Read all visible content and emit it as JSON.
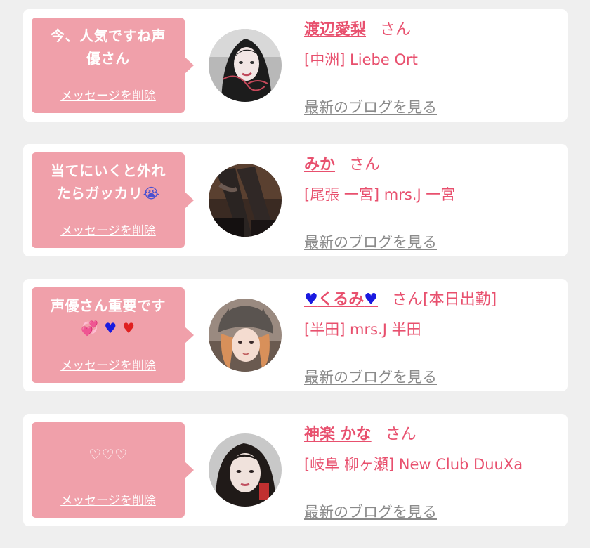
{
  "cards": [
    {
      "message": "今、人気ですね声\n優さん",
      "delete_label": "メッセージを削除",
      "name": "渡辺愛梨",
      "san": "さん",
      "shop": "[中洲] Liebe Ort",
      "blog_label": "最新のブログを見る",
      "avatar_icon": "woman-portrait-1"
    },
    {
      "message": "当てにいくと外れ\nたらガッカリ",
      "message_emoji": "😭",
      "delete_label": "メッセージを削除",
      "name": "みか",
      "san": "さん",
      "shop": "[尾張 一宮] mrs.J 一宮",
      "blog_label": "最新のブログを見る",
      "avatar_icon": "legs-photo"
    },
    {
      "message": "声優さん重要です",
      "message_emoji_1": "💞",
      "message_emoji_2": "♥",
      "message_emoji_3": "♥",
      "delete_label": "メッセージを削除",
      "name": "くるみ",
      "name_heart": "♥",
      "san": "さん[本日出勤]",
      "shop": "[半田] mrs.J 半田",
      "blog_label": "最新のブログを見る",
      "avatar_icon": "woman-hat-portrait"
    },
    {
      "message": "♡♡♡",
      "delete_label": "メッセージを削除",
      "name": "神楽 かな",
      "san": "さん",
      "shop": "[岐阜 柳ヶ瀬] New Club DuuXa",
      "blog_label": "最新のブログを見る",
      "avatar_icon": "woman-portrait-2"
    }
  ],
  "colors": {
    "bubble": "#f0a0aa",
    "name": "#e8506e",
    "blog": "#8a8a8a",
    "background": "#efefef"
  }
}
